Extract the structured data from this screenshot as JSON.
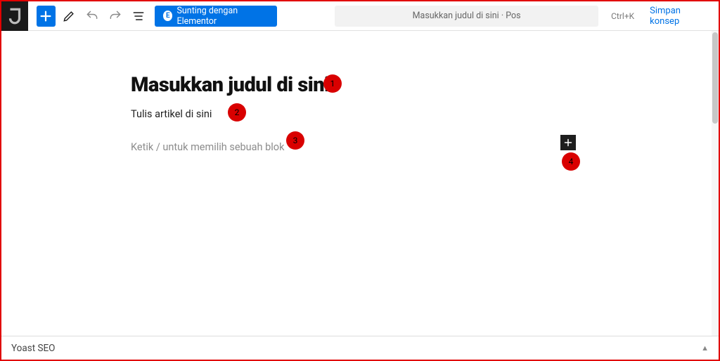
{
  "toolbar": {
    "elementor_label": "Sunting dengan Elementor",
    "elementor_icon_text": "E"
  },
  "header": {
    "title_pill": "Masukkan judul di sini · Pos",
    "shortcut": "Ctrl+K",
    "save_draft": "Simpan konsep"
  },
  "editor": {
    "title": "Masukkan judul di sini",
    "paragraph": "Tulis artikel di sini",
    "block_placeholder": "Ketik / untuk memilih sebuah blok"
  },
  "annotations": {
    "a1": "1",
    "a2": "2",
    "a3": "3",
    "a4": "4"
  },
  "footer": {
    "yoast_label": "Yoast SEO"
  }
}
